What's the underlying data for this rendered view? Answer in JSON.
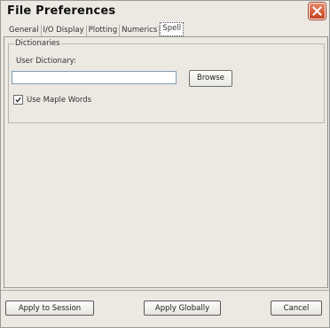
{
  "window": {
    "title": "File Preferences"
  },
  "tabs": [
    {
      "label": "General",
      "active": false
    },
    {
      "label": "I/O Display",
      "active": false
    },
    {
      "label": "Plotting",
      "active": false
    },
    {
      "label": "Numerics",
      "active": false
    },
    {
      "label": "Spell",
      "active": true
    }
  ],
  "dictionaries": {
    "group_title": "Dictionaries",
    "user_dictionary_label": "User Dictionary:",
    "user_dictionary_value": "",
    "browse_label": "Browse",
    "use_maple_words_label": "Use Maple Words",
    "use_maple_words_checked": true
  },
  "footer": {
    "apply_session_label": "Apply to Session",
    "apply_globally_label": "Apply Globally",
    "cancel_label": "Cancel"
  },
  "icons": {
    "close": "close-icon",
    "checkmark": "checkmark-icon"
  },
  "colors": {
    "close_button": "#c3411d",
    "window_bg": "#ece9e3"
  }
}
